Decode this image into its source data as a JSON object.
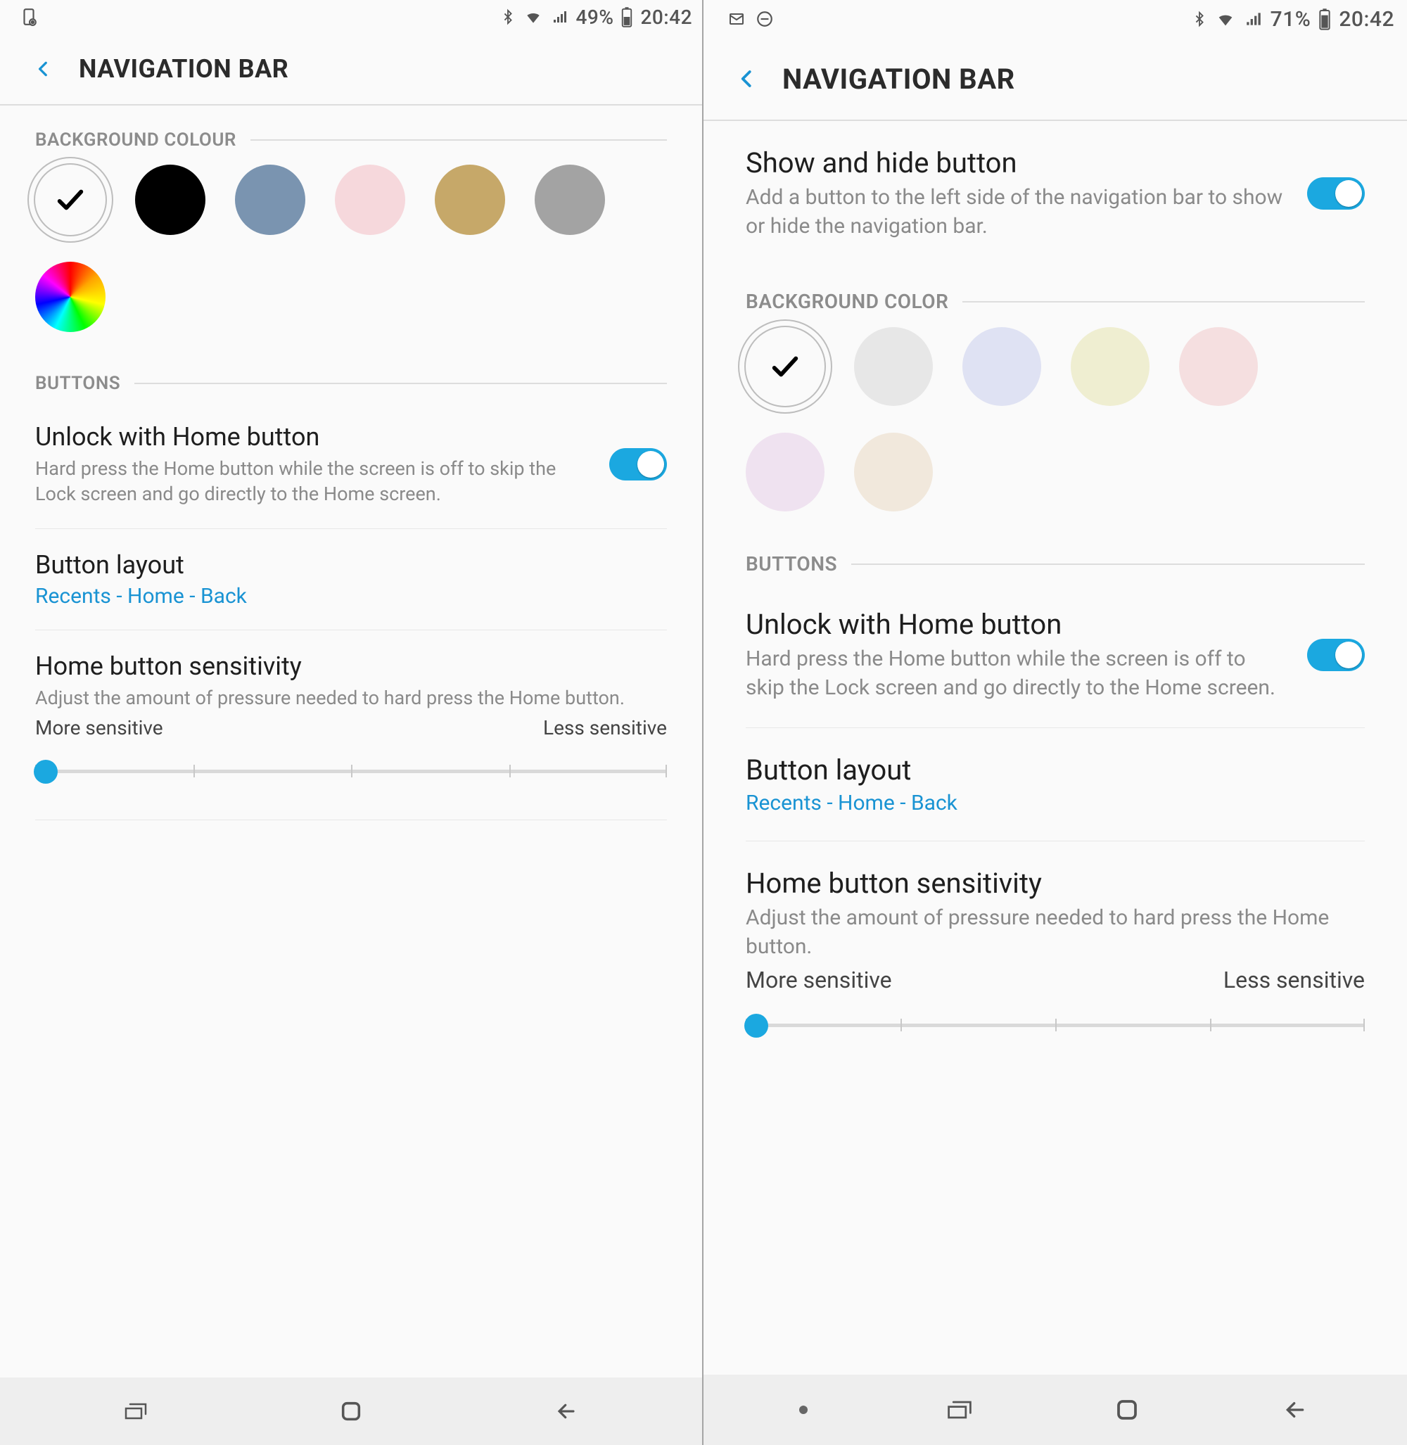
{
  "left": {
    "status": {
      "battery_pct": "49%",
      "time": "20:42"
    },
    "header": {
      "title": "NAVIGATION BAR"
    },
    "background_section": "BACKGROUND COLOUR",
    "colors": [
      "#fafafa",
      "#000000",
      "#7a94b0",
      "#f6d8dc",
      "#c6a869",
      "#a3a3a3",
      "rainbow"
    ],
    "selected_color_index": 0,
    "buttons_section": "BUTTONS",
    "unlock": {
      "title": "Unlock with Home button",
      "desc": "Hard press the Home button while the screen is off to skip the Lock screen and go directly to the Home screen.",
      "on": true
    },
    "layout": {
      "title": "Button layout",
      "value": "Recents - Home - Back"
    },
    "sensitivity": {
      "title": "Home button sensitivity",
      "desc": "Adjust the amount of pressure needed to hard press the Home button.",
      "more": "More sensitive",
      "less": "Less sensitive",
      "value": 0
    },
    "nav_has_dot": false
  },
  "right": {
    "status": {
      "battery_pct": "71%",
      "time": "20:42"
    },
    "header": {
      "title": "NAVIGATION BAR"
    },
    "showhide": {
      "title": "Show and hide button",
      "desc": "Add a button to the left side of the navigation bar to show or hide the navigation bar.",
      "on": true
    },
    "background_section": "BACKGROUND COLOR",
    "colors": [
      "#fafafa",
      "#e7e7e7",
      "#dfe2f3",
      "#efeed1",
      "#f5dfe0",
      "#efe2f0",
      "#f1e8dc"
    ],
    "selected_color_index": 0,
    "buttons_section": "BUTTONS",
    "unlock": {
      "title": "Unlock with Home button",
      "desc": "Hard press the Home button while the screen is off to skip the Lock screen and go directly to the Home screen.",
      "on": true
    },
    "layout": {
      "title": "Button layout",
      "value": "Recents - Home - Back"
    },
    "sensitivity": {
      "title": "Home button sensitivity",
      "desc": "Adjust the amount of pressure needed to hard press the Home button.",
      "more": "More sensitive",
      "less": "Less sensitive",
      "value": 0
    },
    "nav_has_dot": true
  }
}
